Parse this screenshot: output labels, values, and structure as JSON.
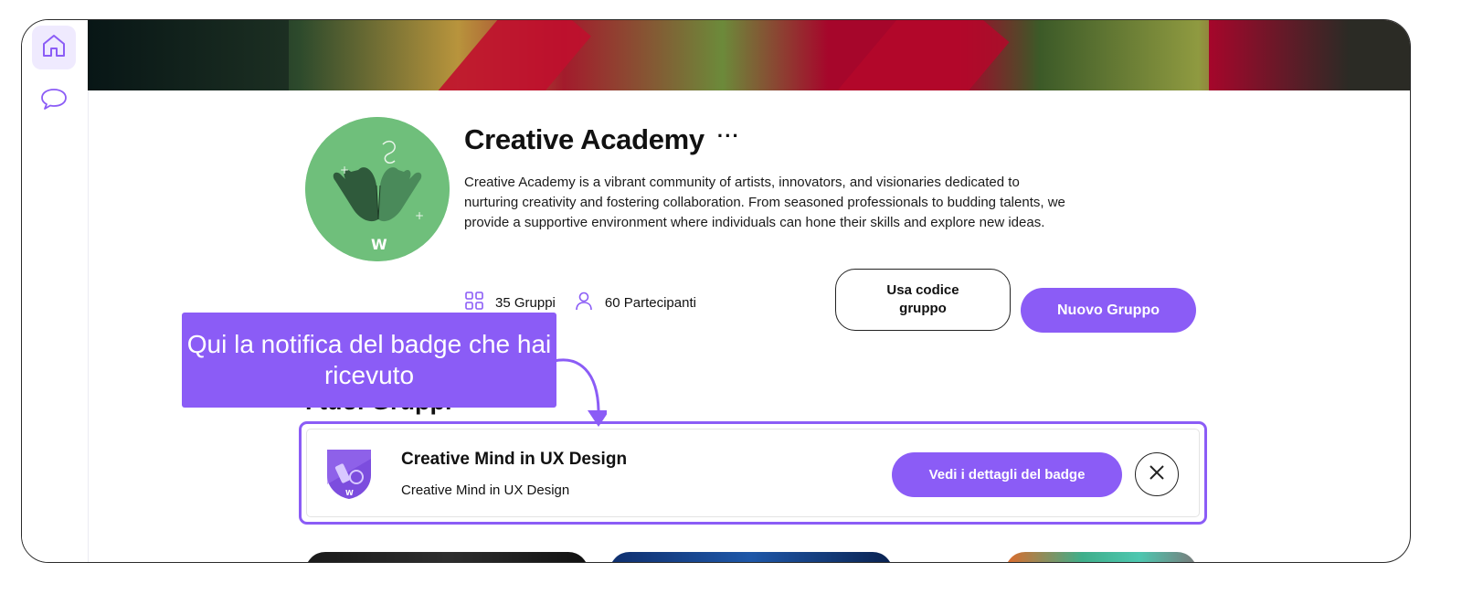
{
  "sidebar": {
    "items": [
      {
        "icon": "home-icon",
        "active": true
      },
      {
        "icon": "chat-icon",
        "active": false
      }
    ]
  },
  "community": {
    "title": "Creative Academy",
    "more_label": "···",
    "description": "Creative Academy is a vibrant community of artists, innovators, and visionaries dedicated to nurturing creativity and fostering collaboration. From seasoned professionals to budding talents, we provide a supportive environment where individuals can hone their skills and explore new ideas.",
    "stats": {
      "groups": "35 Gruppi",
      "participants": "60 Partecipanti"
    },
    "avatar_mark": "W"
  },
  "actions": {
    "use_code": "Usa codice gruppo",
    "new_group": "Nuovo Gruppo"
  },
  "section": {
    "title": "I tuoi Gruppi"
  },
  "tooltip": {
    "text": "Qui la notifica del badge che hai ricevuto"
  },
  "notification": {
    "title": "Creative Mind in UX Design",
    "subtitle": "Creative Mind in UX Design",
    "details_button": "Vedi i dettagli del badge",
    "badge_mark": "W"
  },
  "colors": {
    "accent": "#8b5cf6",
    "accent_light": "#efeafe",
    "avatar_bg": "#6fbf7b"
  }
}
